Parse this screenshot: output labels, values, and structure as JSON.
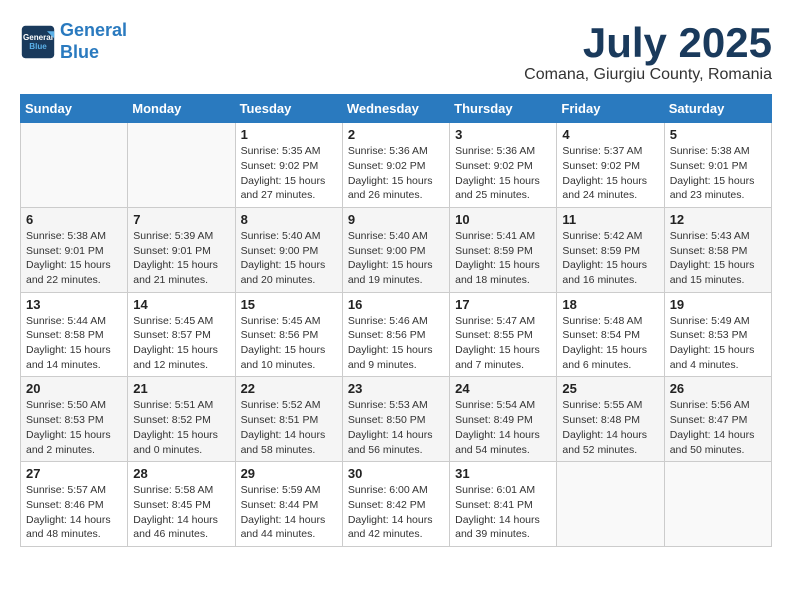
{
  "header": {
    "logo_line1": "General",
    "logo_line2": "Blue",
    "month": "July 2025",
    "location": "Comana, Giurgiu County, Romania"
  },
  "weekdays": [
    "Sunday",
    "Monday",
    "Tuesday",
    "Wednesday",
    "Thursday",
    "Friday",
    "Saturday"
  ],
  "weeks": [
    [
      null,
      null,
      {
        "day": 1,
        "sunrise": "5:35 AM",
        "sunset": "9:02 PM",
        "daylight": "15 hours and 27 minutes."
      },
      {
        "day": 2,
        "sunrise": "5:36 AM",
        "sunset": "9:02 PM",
        "daylight": "15 hours and 26 minutes."
      },
      {
        "day": 3,
        "sunrise": "5:36 AM",
        "sunset": "9:02 PM",
        "daylight": "15 hours and 25 minutes."
      },
      {
        "day": 4,
        "sunrise": "5:37 AM",
        "sunset": "9:02 PM",
        "daylight": "15 hours and 24 minutes."
      },
      {
        "day": 5,
        "sunrise": "5:38 AM",
        "sunset": "9:01 PM",
        "daylight": "15 hours and 23 minutes."
      }
    ],
    [
      {
        "day": 6,
        "sunrise": "5:38 AM",
        "sunset": "9:01 PM",
        "daylight": "15 hours and 22 minutes."
      },
      {
        "day": 7,
        "sunrise": "5:39 AM",
        "sunset": "9:01 PM",
        "daylight": "15 hours and 21 minutes."
      },
      {
        "day": 8,
        "sunrise": "5:40 AM",
        "sunset": "9:00 PM",
        "daylight": "15 hours and 20 minutes."
      },
      {
        "day": 9,
        "sunrise": "5:40 AM",
        "sunset": "9:00 PM",
        "daylight": "15 hours and 19 minutes."
      },
      {
        "day": 10,
        "sunrise": "5:41 AM",
        "sunset": "8:59 PM",
        "daylight": "15 hours and 18 minutes."
      },
      {
        "day": 11,
        "sunrise": "5:42 AM",
        "sunset": "8:59 PM",
        "daylight": "15 hours and 16 minutes."
      },
      {
        "day": 12,
        "sunrise": "5:43 AM",
        "sunset": "8:58 PM",
        "daylight": "15 hours and 15 minutes."
      }
    ],
    [
      {
        "day": 13,
        "sunrise": "5:44 AM",
        "sunset": "8:58 PM",
        "daylight": "15 hours and 14 minutes."
      },
      {
        "day": 14,
        "sunrise": "5:45 AM",
        "sunset": "8:57 PM",
        "daylight": "15 hours and 12 minutes."
      },
      {
        "day": 15,
        "sunrise": "5:45 AM",
        "sunset": "8:56 PM",
        "daylight": "15 hours and 10 minutes."
      },
      {
        "day": 16,
        "sunrise": "5:46 AM",
        "sunset": "8:56 PM",
        "daylight": "15 hours and 9 minutes."
      },
      {
        "day": 17,
        "sunrise": "5:47 AM",
        "sunset": "8:55 PM",
        "daylight": "15 hours and 7 minutes."
      },
      {
        "day": 18,
        "sunrise": "5:48 AM",
        "sunset": "8:54 PM",
        "daylight": "15 hours and 6 minutes."
      },
      {
        "day": 19,
        "sunrise": "5:49 AM",
        "sunset": "8:53 PM",
        "daylight": "15 hours and 4 minutes."
      }
    ],
    [
      {
        "day": 20,
        "sunrise": "5:50 AM",
        "sunset": "8:53 PM",
        "daylight": "15 hours and 2 minutes."
      },
      {
        "day": 21,
        "sunrise": "5:51 AM",
        "sunset": "8:52 PM",
        "daylight": "15 hours and 0 minutes."
      },
      {
        "day": 22,
        "sunrise": "5:52 AM",
        "sunset": "8:51 PM",
        "daylight": "14 hours and 58 minutes."
      },
      {
        "day": 23,
        "sunrise": "5:53 AM",
        "sunset": "8:50 PM",
        "daylight": "14 hours and 56 minutes."
      },
      {
        "day": 24,
        "sunrise": "5:54 AM",
        "sunset": "8:49 PM",
        "daylight": "14 hours and 54 minutes."
      },
      {
        "day": 25,
        "sunrise": "5:55 AM",
        "sunset": "8:48 PM",
        "daylight": "14 hours and 52 minutes."
      },
      {
        "day": 26,
        "sunrise": "5:56 AM",
        "sunset": "8:47 PM",
        "daylight": "14 hours and 50 minutes."
      }
    ],
    [
      {
        "day": 27,
        "sunrise": "5:57 AM",
        "sunset": "8:46 PM",
        "daylight": "14 hours and 48 minutes."
      },
      {
        "day": 28,
        "sunrise": "5:58 AM",
        "sunset": "8:45 PM",
        "daylight": "14 hours and 46 minutes."
      },
      {
        "day": 29,
        "sunrise": "5:59 AM",
        "sunset": "8:44 PM",
        "daylight": "14 hours and 44 minutes."
      },
      {
        "day": 30,
        "sunrise": "6:00 AM",
        "sunset": "8:42 PM",
        "daylight": "14 hours and 42 minutes."
      },
      {
        "day": 31,
        "sunrise": "6:01 AM",
        "sunset": "8:41 PM",
        "daylight": "14 hours and 39 minutes."
      },
      null,
      null
    ]
  ]
}
